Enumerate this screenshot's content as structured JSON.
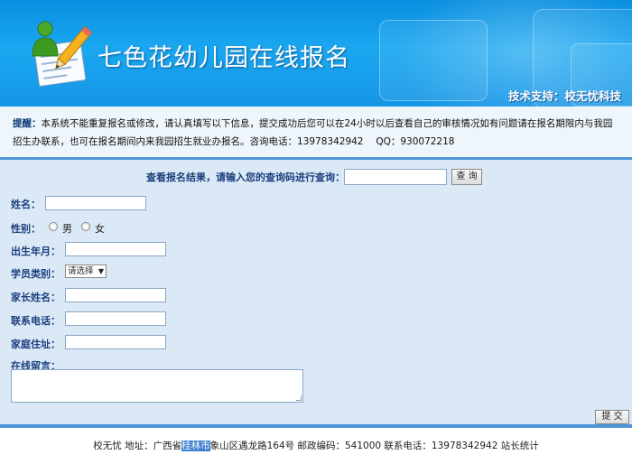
{
  "header": {
    "site_title": "七色花幼儿园在线报名",
    "tech_support": "技术支持：校无忧科技"
  },
  "notice": {
    "label": "提醒：",
    "text": "本系统不能重复报名或修改，请认真填写以下信息，提交成功后您可以在24小时以后查看自己的审核情况如有问题请在报名期限内与我园招生办联系，也可在报名期间内来我园招生就业办报名。咨询电话：13978342942　 QQ：930072218"
  },
  "query": {
    "label": "查看报名结果，请输入您的查询码进行查询：",
    "input_value": "",
    "button": "查 询"
  },
  "form": {
    "name_label": "姓名：",
    "gender_label": "性别：",
    "gender_options": [
      "男",
      "女"
    ],
    "birthdate_label": "出生年月：",
    "category_label": "学员类别：",
    "category_selected": "请选择",
    "parent_label": "家长姓名：",
    "phone_label": "联系电话：",
    "address_label": "家庭住址：",
    "message_label": "在线留言：",
    "submit": "提 交"
  },
  "footer": {
    "prefix": "校无忧 地址：广西省",
    "highlight": "桂林市",
    "suffix": "象山区遇龙路164号 邮政编码：541000 联系电话：13978342942 站长统计"
  },
  "colors": {
    "header_blue": "#1aa7f0",
    "label_navy": "#1a3f7e",
    "form_bg": "#dbe8f5",
    "divider": "#4f94d8"
  }
}
